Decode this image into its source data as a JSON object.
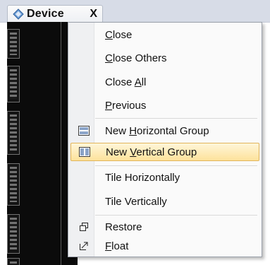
{
  "tab": {
    "title": "Device",
    "close": "X",
    "icon": "device-icon"
  },
  "menu": {
    "items": [
      {
        "pre": "",
        "acc": "C",
        "post": "lose",
        "icon": ""
      },
      {
        "pre": "",
        "acc": "C",
        "post": "lose Others",
        "icon": ""
      },
      {
        "pre": "Close ",
        "acc": "A",
        "post": "ll",
        "icon": ""
      },
      {
        "pre": "",
        "acc": "P",
        "post": "revious",
        "icon": ""
      },
      {
        "pre": "New ",
        "acc": "H",
        "post": "orizontal Group",
        "icon": "horizontal-group-icon"
      },
      {
        "pre": "New ",
        "acc": "V",
        "post": "ertical Group",
        "icon": "vertical-group-icon",
        "highlighted": true
      },
      {
        "pre": "Tile Horizontally",
        "acc": "",
        "post": "",
        "icon": ""
      },
      {
        "pre": "Tile Vertically",
        "acc": "",
        "post": "",
        "icon": ""
      },
      {
        "pre": "Restore",
        "acc": "",
        "post": "",
        "icon": "restore-icon"
      },
      {
        "pre": "",
        "acc": "F",
        "post": "loat",
        "icon": "float-icon"
      }
    ]
  },
  "colors": {
    "highlight": "#fde29b",
    "highlight_border": "#e1b55a",
    "menu_bg": "#fafafa",
    "device_bg": "#0b0b0b"
  }
}
